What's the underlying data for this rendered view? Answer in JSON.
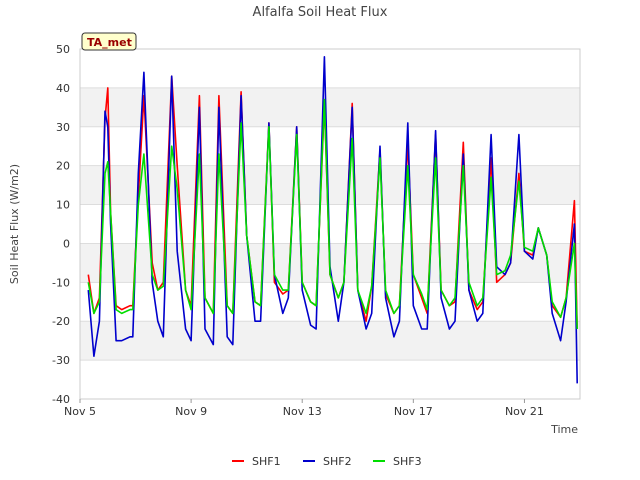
{
  "chart_data": {
    "type": "line",
    "title": "Alfalfa Soil Heat Flux",
    "xlabel": "Time",
    "ylabel": "Soil Heat Flux (W/m2)",
    "badge": "TA_met",
    "ylim": [
      -40,
      50
    ],
    "yticks": [
      -40,
      -30,
      -20,
      -10,
      0,
      10,
      20,
      30,
      40,
      50
    ],
    "xlim": [
      0,
      18
    ],
    "xticks": [
      {
        "v": 0,
        "label": "Nov 5"
      },
      {
        "v": 4,
        "label": "Nov 9"
      },
      {
        "v": 8,
        "label": "Nov 13"
      },
      {
        "v": 12,
        "label": "Nov 17"
      },
      {
        "v": 16,
        "label": "Nov 21"
      }
    ],
    "grid": true,
    "legend_position": "bottom",
    "series": [
      {
        "name": "SHF1",
        "color": "#ff0000",
        "x": [
          0.3,
          0.5,
          0.7,
          0.9,
          1.0,
          1.1,
          1.3,
          1.5,
          1.8,
          1.9,
          2.1,
          2.3,
          2.6,
          2.8,
          3.0,
          3.3,
          3.5,
          3.8,
          4.0,
          4.3,
          4.5,
          4.8,
          5.0,
          5.3,
          5.5,
          5.8,
          6.0,
          6.3,
          6.5,
          6.8,
          7.0,
          7.3,
          7.5,
          7.8,
          8.0,
          8.3,
          8.5,
          8.8,
          9.0,
          9.3,
          9.5,
          9.8,
          10.0,
          10.3,
          10.5,
          10.8,
          11.0,
          11.3,
          11.5,
          11.8,
          12.0,
          12.3,
          12.5,
          12.8,
          13.0,
          13.3,
          13.5,
          13.8,
          14.0,
          14.3,
          14.5,
          14.8,
          15.0,
          15.3,
          15.5,
          15.8,
          16.0,
          16.3,
          16.5,
          16.8,
          17.0,
          17.3,
          17.5,
          17.8,
          17.9
        ],
        "y": [
          -8,
          -18,
          -14,
          32,
          40,
          8,
          -16,
          -17,
          -16,
          -16,
          12,
          38,
          -5,
          -12,
          -10,
          43,
          20,
          -12,
          -16,
          38,
          -14,
          -18,
          38,
          -16,
          -18,
          39,
          2,
          -15,
          -16,
          31,
          -10,
          -13,
          -12,
          30,
          -10,
          -15,
          -16,
          36,
          -8,
          -14,
          -10,
          36,
          -12,
          -20,
          -11,
          24,
          -13,
          -18,
          -16,
          26,
          -8,
          -14,
          -18,
          28,
          -12,
          -16,
          -15,
          26,
          -12,
          -17,
          -15,
          22,
          -10,
          -8,
          -5,
          18,
          -2,
          -3,
          4,
          -3,
          -16,
          -19,
          -14,
          11,
          -22
        ],
        "values_note": "x in days after Nov 5"
      },
      {
        "name": "SHF2",
        "color": "#0000cc",
        "x": [
          0.3,
          0.5,
          0.7,
          0.9,
          1.0,
          1.1,
          1.3,
          1.5,
          1.8,
          1.9,
          2.1,
          2.3,
          2.6,
          2.8,
          3.0,
          3.3,
          3.5,
          3.8,
          4.0,
          4.3,
          4.5,
          4.8,
          5.0,
          5.3,
          5.5,
          5.8,
          6.0,
          6.3,
          6.5,
          6.8,
          7.0,
          7.3,
          7.5,
          7.8,
          8.0,
          8.3,
          8.5,
          8.8,
          9.0,
          9.3,
          9.5,
          9.8,
          10.0,
          10.3,
          10.5,
          10.8,
          11.0,
          11.3,
          11.5,
          11.8,
          12.0,
          12.3,
          12.5,
          12.8,
          13.0,
          13.3,
          13.5,
          13.8,
          14.0,
          14.3,
          14.5,
          14.8,
          15.0,
          15.3,
          15.5,
          15.8,
          16.0,
          16.3,
          16.5,
          16.8,
          17.0,
          17.3,
          17.5,
          17.8,
          17.9
        ],
        "y": [
          -12,
          -29,
          -20,
          34,
          30,
          5,
          -25,
          -25,
          -24,
          -24,
          18,
          44,
          -10,
          -20,
          -24,
          43,
          -2,
          -22,
          -25,
          35,
          -22,
          -26,
          35,
          -24,
          -26,
          38,
          2,
          -20,
          -20,
          31,
          -8,
          -18,
          -14,
          30,
          -12,
          -21,
          -22,
          48,
          -6,
          -20,
          -10,
          35,
          -12,
          -22,
          -18,
          25,
          -14,
          -24,
          -20,
          31,
          -16,
          -22,
          -22,
          29,
          -14,
          -22,
          -20,
          23,
          -12,
          -20,
          -18,
          28,
          -6,
          -8,
          -5,
          28,
          -2,
          -4,
          4,
          -3,
          -18,
          -25,
          -15,
          5,
          -36
        ],
        "values_note": "x in days after Nov 5"
      },
      {
        "name": "SHF3",
        "color": "#00dd00",
        "x": [
          0.3,
          0.5,
          0.7,
          0.9,
          1.0,
          1.1,
          1.3,
          1.5,
          1.8,
          1.9,
          2.1,
          2.3,
          2.6,
          2.8,
          3.0,
          3.3,
          3.5,
          3.8,
          4.0,
          4.3,
          4.5,
          4.8,
          5.0,
          5.3,
          5.5,
          5.8,
          6.0,
          6.3,
          6.5,
          6.8,
          7.0,
          7.3,
          7.5,
          7.8,
          8.0,
          8.3,
          8.5,
          8.8,
          9.0,
          9.3,
          9.5,
          9.8,
          10.0,
          10.3,
          10.5,
          10.8,
          11.0,
          11.3,
          11.5,
          11.8,
          12.0,
          12.3,
          12.5,
          12.8,
          13.0,
          13.3,
          13.5,
          13.8,
          14.0,
          14.3,
          14.5,
          14.8,
          15.0,
          15.3,
          15.5,
          15.8,
          16.0,
          16.3,
          16.5,
          16.8,
          17.0,
          17.3,
          17.5,
          17.8,
          17.9
        ],
        "y": [
          -10,
          -18,
          -15,
          18,
          21,
          8,
          -17,
          -18,
          -17,
          -17,
          10,
          23,
          -8,
          -12,
          -11,
          25,
          14,
          -12,
          -17,
          23,
          -14,
          -18,
          23,
          -16,
          -18,
          31,
          2,
          -15,
          -16,
          30,
          -8,
          -12,
          -12,
          28,
          -10,
          -15,
          -16,
          37,
          -8,
          -14,
          -10,
          27,
          -12,
          -18,
          -11,
          22,
          -12,
          -18,
          -16,
          20,
          -8,
          -13,
          -17,
          22,
          -12,
          -16,
          -14,
          20,
          -10,
          -16,
          -14,
          17,
          -8,
          -7,
          -3,
          16,
          -1,
          -2,
          4,
          -3,
          -15,
          -19,
          -14,
          0,
          -22
        ],
        "values_note": "x in days after Nov 5"
      }
    ]
  }
}
